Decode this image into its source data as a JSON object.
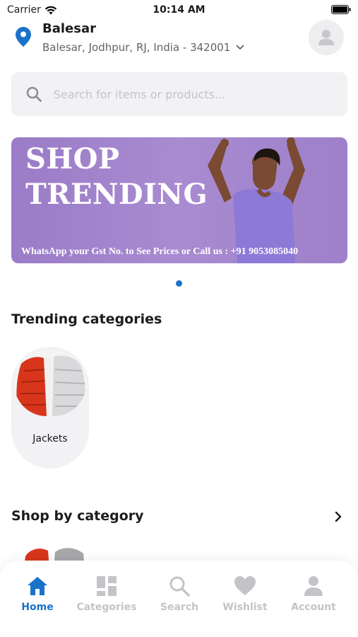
{
  "status_bar": {
    "carrier": "Carrier",
    "time": "10:14 AM"
  },
  "location": {
    "title": "Balesar",
    "address": "Balesar, Jodhpur, RJ, India - 342001"
  },
  "search": {
    "placeholder": "Search for items or products..."
  },
  "banner": {
    "title": "SHOP\nTRENDING",
    "caption": "WhatsApp your Gst No. to See Prices or Call us : +91 9053085040",
    "background": "#a98bd1"
  },
  "sections": {
    "trending": "Trending categories",
    "shop_by_category": "Shop by category"
  },
  "trending_categories": [
    {
      "label": "Jackets",
      "icon": "jacket-image"
    }
  ],
  "tabs": [
    {
      "label": "Home",
      "icon": "home-icon",
      "active": true
    },
    {
      "label": "Categories",
      "icon": "categories-icon",
      "active": false
    },
    {
      "label": "Search",
      "icon": "search-icon",
      "active": false
    },
    {
      "label": "Wishlist",
      "icon": "heart-icon",
      "active": false
    },
    {
      "label": "Account",
      "icon": "user-icon",
      "active": false
    }
  ],
  "colors": {
    "accent": "#1a73c9",
    "inactive": "#c4c4c8",
    "surface": "#f2f2f4"
  }
}
